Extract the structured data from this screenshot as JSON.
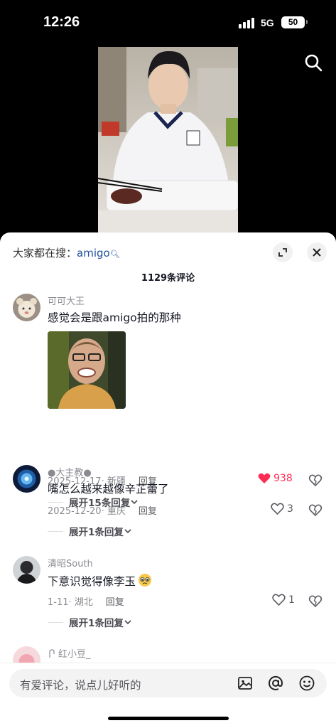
{
  "status_bar": {
    "time": "12:26",
    "network": "5G",
    "battery": "50"
  },
  "sheet": {
    "search_prefix": "大家都在搜：",
    "search_keyword": "amigo",
    "comment_count": "1129条评论"
  },
  "comments": [
    {
      "username": "可可大王",
      "text": "感觉会是跟amigo拍的那种",
      "date": "2025-12-17",
      "location": "· 新疆",
      "reply": "回复",
      "likes": "938",
      "liked": true,
      "expand": "展开15条回复"
    },
    {
      "username": "●大主教●",
      "text": "嘴怎么越来越像辛芷蕾了",
      "date": "2025-12-20",
      "location": "· 重庆",
      "reply": "回复",
      "likes": "3",
      "expand": "展开1条回复"
    },
    {
      "username": "清昭South",
      "text": "下意识觉得像李玉",
      "date": "1-11",
      "location": "· 湖北",
      "reply": "回复",
      "likes": "1",
      "expand": "展开1条回复"
    },
    {
      "username": "红小豆_"
    }
  ],
  "input": {
    "placeholder": "有爱评论，说点儿好听的"
  },
  "icons": {
    "search": "search-icon",
    "expand": "expand-icon",
    "close": "close-icon",
    "heart": "heart-icon",
    "dislike": "dislike-icon",
    "image": "image-icon",
    "at": "at-icon",
    "emoji": "emoji-icon"
  },
  "colors": {
    "like_red": "#fe2c55",
    "keyword_blue": "#1d4e9e"
  }
}
